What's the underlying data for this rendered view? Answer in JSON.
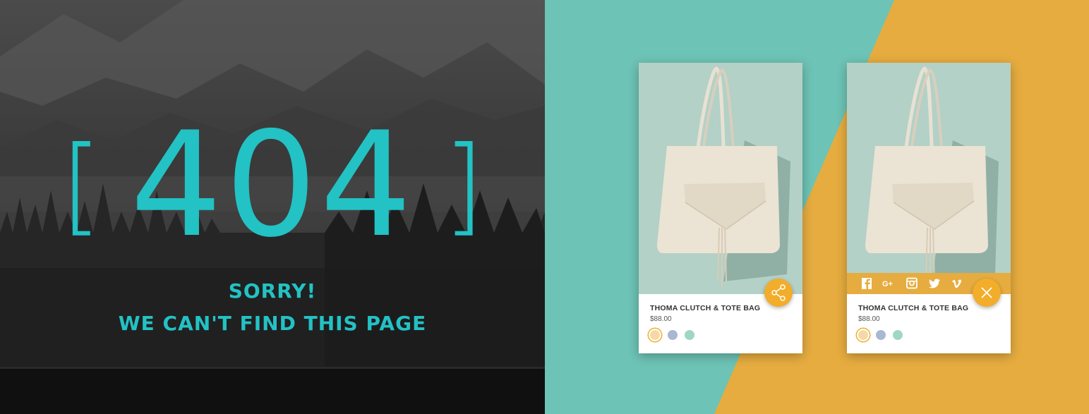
{
  "error_panel": {
    "code": "404",
    "bracket_left": "[",
    "bracket_right": "]",
    "line1": "SORRY!",
    "line2": "WE CAN'T FIND THIS PAGE",
    "accent_color": "#23c2c4"
  },
  "colors": {
    "teal_bg": "#6dc3b5",
    "yellow_bg": "#e6ac3f",
    "fab": "#f2ad2b"
  },
  "products": [
    {
      "name": "THOMA CLUTCH & TOTE BAG",
      "price": "$88.00",
      "swatches": [
        "#f4d9a8",
        "#a9b7d3",
        "#9fd6c8"
      ],
      "selected_swatch": 0,
      "action_icon": "share-icon",
      "share_open": false
    },
    {
      "name": "THOMA CLUTCH & TOTE BAG",
      "price": "$88.00",
      "swatches": [
        "#f4d9a8",
        "#a9b7d3",
        "#9fd6c8"
      ],
      "selected_swatch": 0,
      "action_icon": "close-icon",
      "share_open": true,
      "social_icons": [
        "facebook-icon",
        "google-plus-icon",
        "instagram-icon",
        "twitter-icon",
        "vimeo-icon"
      ],
      "social_labels": [
        "f",
        "G+",
        "◙",
        "🐦",
        "V"
      ]
    }
  ]
}
